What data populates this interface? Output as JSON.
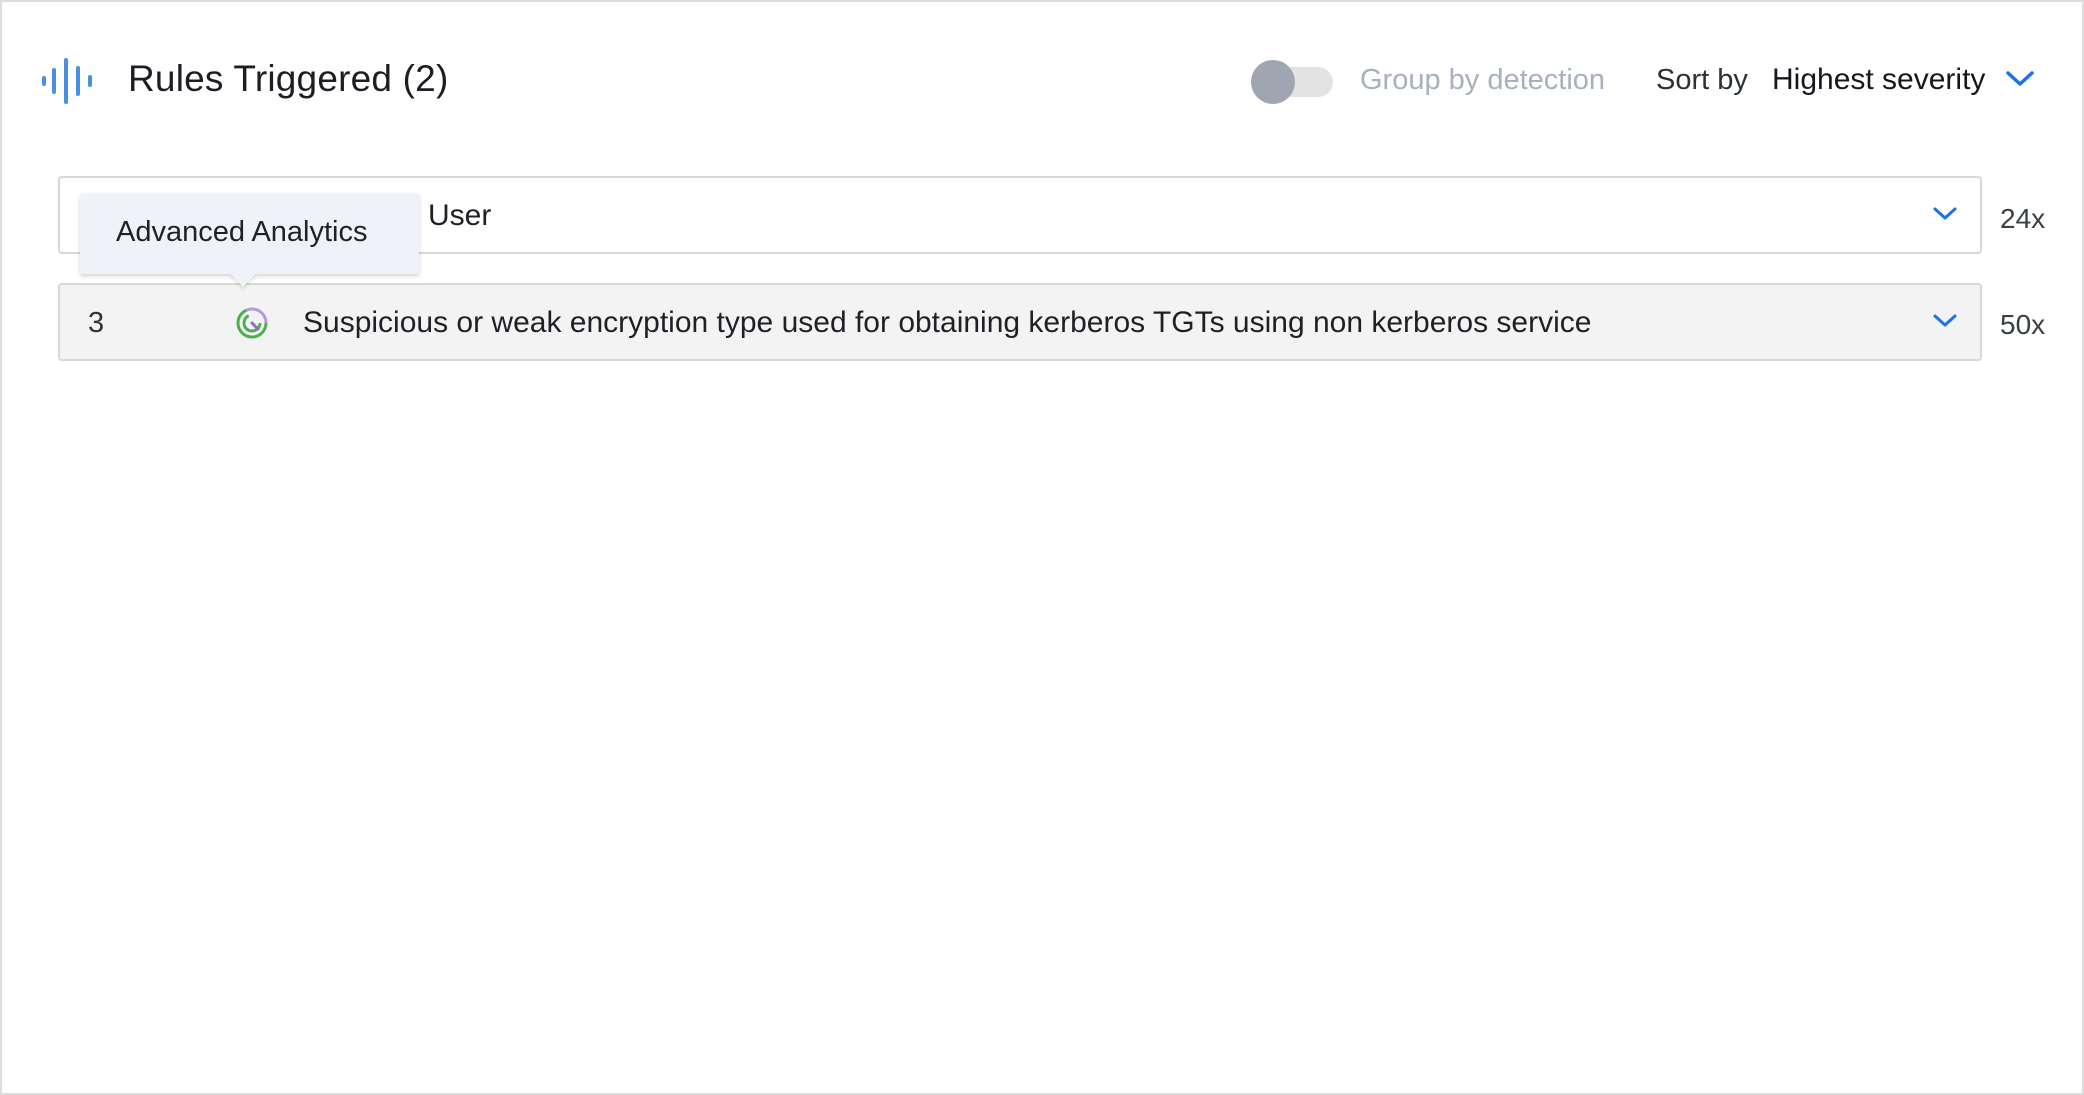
{
  "header": {
    "title": "Rules Triggered (2)",
    "group_toggle_label": "Group by detection",
    "group_toggle_on": false,
    "sort_label": "Sort by",
    "sort_value": "Highest severity"
  },
  "rules": [
    {
      "severity": "",
      "name": "User",
      "count": "24x"
    },
    {
      "severity": "3",
      "name": "Suspicious or weak encryption type used for obtaining kerberos TGTs using non kerberos service",
      "count": "50x",
      "icon": "advanced-analytics-icon"
    }
  ],
  "tooltip": {
    "text": "Advanced Analytics"
  },
  "colors": {
    "accent": "#1a73e8",
    "icon_blue": "#4a90e2",
    "toggle_knob": "#a0a6b1",
    "row_highlight": "#f3f3f3"
  }
}
